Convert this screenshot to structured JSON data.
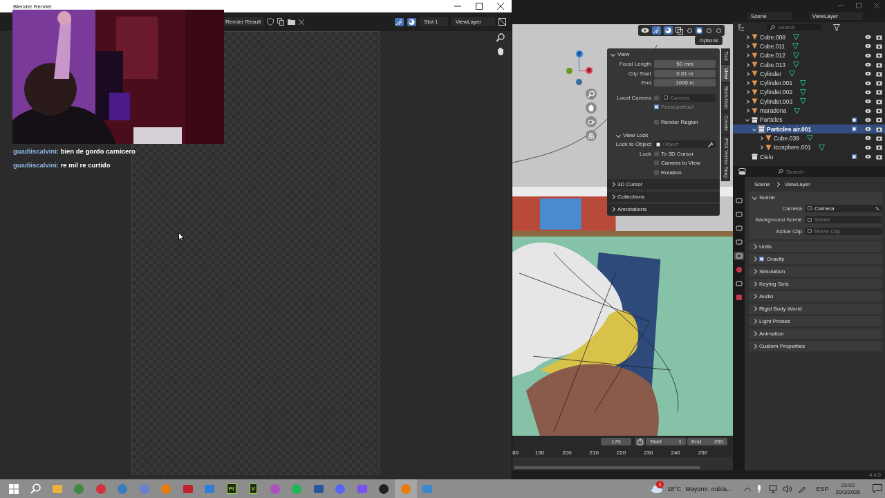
{
  "render_window": {
    "title": "Blender Render",
    "image_name": "Render Result",
    "slot": "Slot 1",
    "view_layer": "ViewLayer"
  },
  "chat": [
    {
      "user": "guadiiscalvini:",
      "message": "bien de gordo carnicero"
    },
    {
      "user": "guadiiscalvini:",
      "message": "re mil re curtido"
    }
  ],
  "header": {
    "scene": "Scene",
    "view_layer": "ViewLayer"
  },
  "viewport": {
    "options": "Options",
    "shading": [
      {
        "selected": false
      },
      {
        "selected": true
      },
      {
        "selected": false
      },
      {
        "selected": false
      }
    ],
    "gizmo": [
      {
        "label": "Z",
        "color": "#2f7fd6"
      },
      {
        "label": "X",
        "color": "#e23a55"
      }
    ]
  },
  "sidebar": {
    "tabs": [
      {
        "label": "Tool",
        "selected": false
      },
      {
        "label": "View",
        "selected": true
      },
      {
        "label": "Sketchfab",
        "selected": false
      },
      {
        "label": "Create",
        "selected": false
      },
      {
        "label": "PSX Vertex Snap",
        "selected": false
      }
    ],
    "view": {
      "title": "View",
      "expanded": true,
      "fields": [
        {
          "label": "Focal Length",
          "value": "50 mm"
        },
        {
          "label": "Clip Start",
          "value": "0.01 m"
        },
        {
          "label": "End",
          "value": "1000 m"
        }
      ],
      "local_camera": {
        "label": "Local Camera",
        "checked": false,
        "placeholder": "Camera"
      },
      "passepartout": {
        "label": "Passepartout",
        "checked": true
      },
      "render_region": {
        "label": "Render Region",
        "checked": false
      }
    },
    "view_lock": {
      "title": "View Lock",
      "expanded": true,
      "lock_to_object": {
        "label": "Lock to Object",
        "placeholder": "Object"
      },
      "lock_label": "Lock",
      "locks": [
        {
          "label": "To 3D Cursor",
          "checked": false
        },
        {
          "label": "Camera to View",
          "checked": false
        },
        {
          "label": "Rotation",
          "checked": false
        }
      ]
    },
    "panels": [
      {
        "title": "3D Cursor",
        "expanded": false
      },
      {
        "title": "Collections",
        "expanded": false
      },
      {
        "title": "Annotations",
        "expanded": false
      }
    ]
  },
  "outliner": {
    "search": {
      "placeholder": "Search"
    },
    "items": [
      {
        "name": "Cube.008",
        "kind": "mesh",
        "expanded": false,
        "selected": false
      },
      {
        "name": "Cube.011",
        "kind": "mesh",
        "expanded": false,
        "selected": false
      },
      {
        "name": "Cube.012",
        "kind": "mesh",
        "expanded": false,
        "selected": false
      },
      {
        "name": "Cube.013",
        "kind": "mesh",
        "expanded": false,
        "selected": false
      },
      {
        "name": "Cylinder",
        "kind": "mesh",
        "expanded": false,
        "selected": false
      },
      {
        "name": "Cylinder.001",
        "kind": "mesh",
        "expanded": false,
        "selected": false
      },
      {
        "name": "Cylinder.002",
        "kind": "mesh",
        "expanded": false,
        "selected": false
      },
      {
        "name": "Cylinder.003",
        "kind": "mesh",
        "expanded": false,
        "selected": false
      },
      {
        "name": "maradona",
        "kind": "mesh",
        "expanded": false,
        "selected": false
      },
      {
        "name": "Particles",
        "kind": "collection",
        "expanded": true,
        "checked": true,
        "selected": false,
        "children": [
          {
            "name": "Particles air.001",
            "kind": "collection",
            "expanded": true,
            "checked": true,
            "selected": true,
            "children": [
              {
                "name": "Cube.039",
                "kind": "mesh",
                "expanded": false,
                "selected": false
              },
              {
                "name": "Icosphere.001",
                "kind": "mesh",
                "expanded": false,
                "selected": false
              }
            ]
          }
        ]
      },
      {
        "name": "Cielo",
        "kind": "collection",
        "checked": true,
        "selected": false
      }
    ]
  },
  "properties": {
    "search": {
      "placeholder": "Search"
    },
    "tabs": [
      {
        "kind": "tool",
        "selected": false
      },
      {
        "kind": "render",
        "selected": false
      },
      {
        "kind": "output",
        "selected": false
      },
      {
        "kind": "view_layer",
        "selected": false
      },
      {
        "kind": "scene",
        "selected": true
      },
      {
        "kind": "world",
        "selected": false
      },
      {
        "kind": "collection",
        "selected": false
      },
      {
        "kind": "texture",
        "selected": false
      }
    ],
    "breadcrumb": [
      "Scene",
      "ViewLayer"
    ],
    "scene_panel": {
      "title": "Scene",
      "expanded": true,
      "fields": [
        {
          "label": "Camera",
          "value": "Camera"
        },
        {
          "label": "Background Scene",
          "placeholder": "Scene"
        },
        {
          "label": "Active Clip",
          "placeholder": "Movie Clip"
        }
      ]
    },
    "panels": [
      {
        "title": "Units",
        "kind": "panel"
      },
      {
        "title": "Gravity",
        "kind": "checkbox",
        "checked": true
      },
      {
        "title": "Simulation",
        "kind": "panel"
      },
      {
        "title": "Keying Sets",
        "kind": "panel"
      },
      {
        "title": "Audio",
        "kind": "panel"
      },
      {
        "title": "Rigid Body World",
        "kind": "panel"
      },
      {
        "title": "Light Probes",
        "kind": "panel"
      },
      {
        "title": "Animation",
        "kind": "panel"
      },
      {
        "title": "Custom Properties",
        "kind": "panel"
      }
    ]
  },
  "timeline": {
    "current_frame": "170",
    "start_label": "Start",
    "start": "1",
    "end_label": "End",
    "end": "250",
    "ruler": [
      "80",
      "190",
      "200",
      "210",
      "220",
      "230",
      "240",
      "250"
    ]
  },
  "version": "4.4.0",
  "taskbar": {
    "apps": [
      {
        "kind": "start",
        "selected": false
      },
      {
        "kind": "search",
        "selected": false
      },
      {
        "kind": "folder",
        "selected": false
      },
      {
        "kind": "browser",
        "selected": false
      },
      {
        "kind": "ring",
        "selected": false
      },
      {
        "kind": "crescent",
        "selected": false
      },
      {
        "kind": "spiral",
        "selected": false
      },
      {
        "kind": "blender",
        "selected": false
      },
      {
        "kind": "mixer",
        "selected": false
      },
      {
        "kind": "photos",
        "selected": false
      },
      {
        "kind": "letter",
        "label": "Pt",
        "selected": false
      },
      {
        "kind": "letter",
        "label": "V",
        "selected": false
      },
      {
        "kind": "paint",
        "selected": false
      },
      {
        "kind": "music",
        "selected": false
      },
      {
        "kind": "word",
        "selected": false
      },
      {
        "kind": "chat",
        "selected": false
      },
      {
        "kind": "play",
        "selected": false
      },
      {
        "kind": "record",
        "selected": false
      },
      {
        "kind": "blender",
        "selected": true
      },
      {
        "kind": "window",
        "selected": false
      }
    ],
    "weather": {
      "temperature": "18°C",
      "summary": "Mayorm. nubla...",
      "badge": "1"
    },
    "language": "ESP",
    "time": "22:02",
    "date": "20/3/2026"
  }
}
